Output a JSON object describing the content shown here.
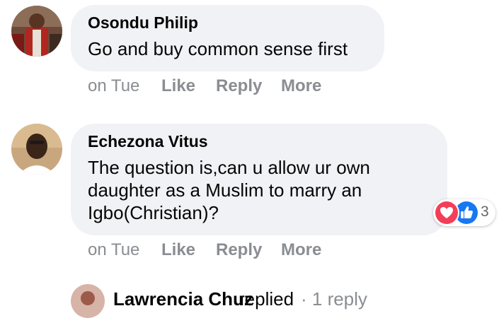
{
  "comments": [
    {
      "author": "Osondu Philip",
      "text": "Go and buy common sense first",
      "time": "on Tue",
      "like_label": "Like",
      "reply_label": "Reply",
      "more_label": "More"
    },
    {
      "author": "Echezona Vitus",
      "text": "The question is,can u allow ur own daughter as a Muslim to marry an Igbo(Christian)?",
      "time": "on Tue",
      "like_label": "Like",
      "reply_label": "Reply",
      "more_label": "More",
      "reactions": {
        "icons": [
          "love-icon",
          "like-icon"
        ],
        "count": "3",
        "colors": {
          "love": "#f33e58",
          "like": "#1877f2"
        }
      }
    }
  ],
  "reply_summary": {
    "author": "Lawrencia Chuz",
    "verb": "replied",
    "meta": "· 1 reply"
  },
  "colors": {
    "bubble": "#f0f2f5",
    "meta_text": "#8a8d91",
    "primary_text": "#050505"
  }
}
